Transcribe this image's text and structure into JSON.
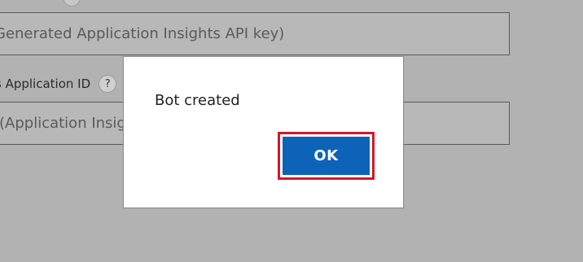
{
  "background_form": {
    "field_1_text": "Generated Application Insights API key)",
    "label_2_text": "s Application ID",
    "help_symbol": "?",
    "field_2_text": "(Application Insigh"
  },
  "modal": {
    "message": "Bot created",
    "ok_label": "OK"
  },
  "colors": {
    "dim_overlay": "#b2b2b2",
    "modal_bg": "#ffffff",
    "primary_button": "#0c63b8",
    "focus_outline": "#d6162a"
  }
}
